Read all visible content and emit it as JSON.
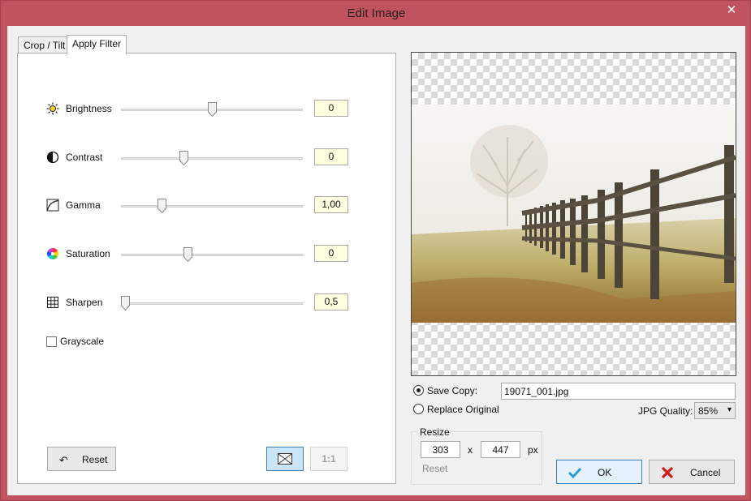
{
  "window": {
    "title": "Edit Image",
    "close_symbol": "✕"
  },
  "tabs": [
    {
      "label": "Crop / Tilt",
      "active": false
    },
    {
      "label": "Apply Filter",
      "active": true
    }
  ],
  "filters": [
    {
      "label": "Brightness",
      "value": "0",
      "icon": "sun-icon",
      "slider_fraction": 0.5
    },
    {
      "label": "Contrast",
      "value": "0",
      "icon": "contrast-icon",
      "slider_fraction": 0.34
    },
    {
      "label": "Gamma",
      "value": "1,00",
      "icon": "gamma-curve-icon",
      "slider_fraction": 0.21
    },
    {
      "label": "Saturation",
      "value": "0",
      "icon": "color-wheel-icon",
      "slider_fraction": 0.36
    },
    {
      "label": "Sharpen",
      "value": "0,5",
      "icon": "grid-icon",
      "slider_fraction": 0.0
    }
  ],
  "grayscale": {
    "label": "Grayscale",
    "checked": false
  },
  "buttons": {
    "reset": "Reset",
    "fit": "fit-to-window-icon",
    "one_to_one": "1:1",
    "ok": "OK",
    "cancel": "Cancel"
  },
  "save": {
    "save_copy_label": "Save Copy:",
    "save_copy_selected": true,
    "filename": "19071_001.jpg",
    "replace_label": "Replace Original",
    "replace_selected": false,
    "jpg_quality_label": "JPG Quality:",
    "jpg_quality_value": "85%"
  },
  "resize": {
    "title": "Resize",
    "width": "303",
    "times": "x",
    "height": "447",
    "unit": "px",
    "reset_label": "Reset"
  },
  "colors": {
    "accent": "#c1535f",
    "ok_green": "#2a9bd8",
    "cancel_red": "#d11b1b",
    "value_field": "#ffffe1"
  }
}
